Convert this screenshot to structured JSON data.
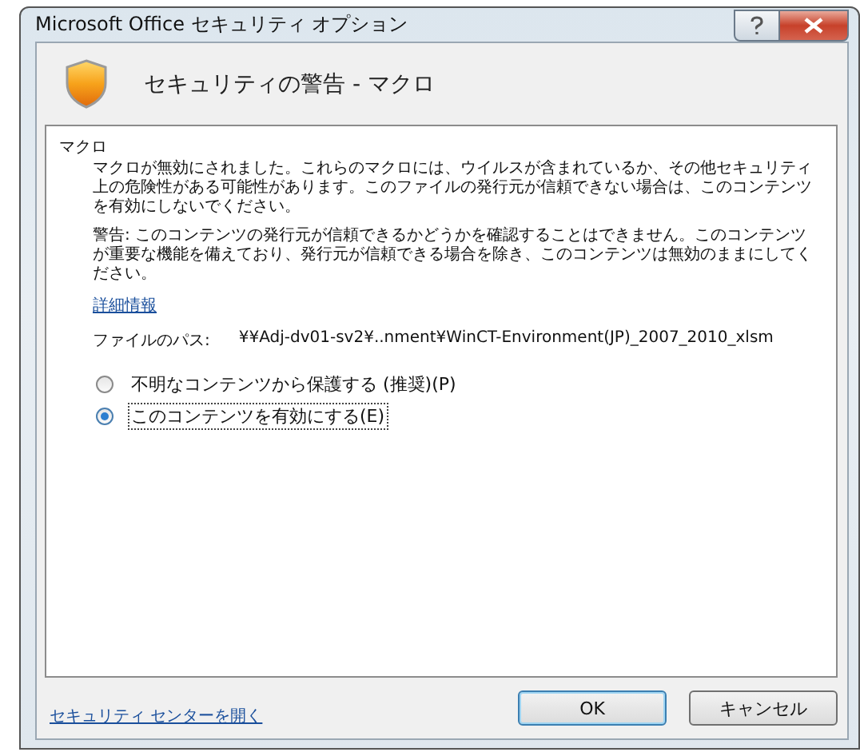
{
  "window": {
    "title": "Microsoft Office セキュリティ オプション"
  },
  "header": {
    "title": "セキュリティの警告 - マクロ"
  },
  "section": {
    "title": "マクロ",
    "paragraphs": [
      "マクロが無効にされました。これらのマクロには、ウイルスが含まれているか、その他セキュリティ上の危険性がある可能性があります。このファイルの発行元が信頼できない場合は、このコンテンツを有効にしないでください。",
      "警告: このコンテンツの発行元が信頼できるかどうかを確認することはできません。このコンテンツが重要な機能を備えており、発行元が信頼できる場合を除き、このコンテンツは無効のままにしてください。"
    ],
    "details_link": "詳細情報",
    "path_label": "ファイルのパス:",
    "path_value": "¥¥Adj-dv01-sv2¥..nment¥WinCT-Environment(JP)_2007_2010_xlsm",
    "options": [
      {
        "label": "不明なコンテンツから保護する (推奨)(P)",
        "selected": false,
        "focused": false
      },
      {
        "label": "このコンテンツを有効にする(E)",
        "selected": true,
        "focused": true
      }
    ]
  },
  "footer": {
    "link": "セキュリティ センターを開く",
    "buttons": [
      {
        "label": "OK",
        "default": true
      },
      {
        "label": "キャンセル",
        "default": false
      }
    ]
  }
}
